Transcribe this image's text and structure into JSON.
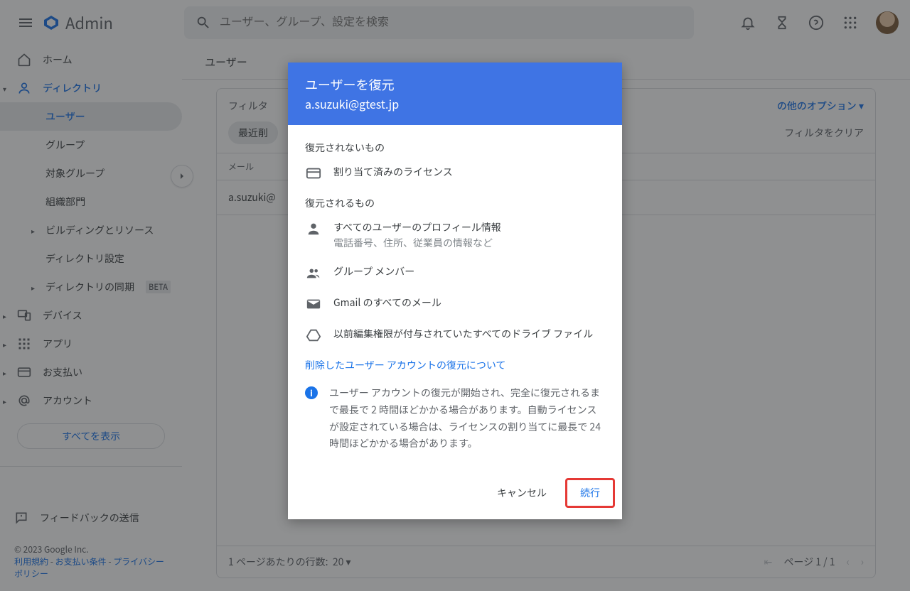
{
  "header": {
    "brand": "Admin",
    "search_placeholder": "ユーザー、グループ、設定を検索"
  },
  "sidebar": {
    "items": [
      {
        "label": "ホーム"
      },
      {
        "label": "ディレクトリ"
      },
      {
        "label": "ユーザー"
      },
      {
        "label": "グループ"
      },
      {
        "label": "対象グループ"
      },
      {
        "label": "組織部門"
      },
      {
        "label": "ビルディングとリソース"
      },
      {
        "label": "ディレクトリ設定"
      },
      {
        "label": "ディレクトリの同期"
      },
      {
        "label": "デバイス"
      },
      {
        "label": "アプリ"
      },
      {
        "label": "お支払い"
      },
      {
        "label": "アカウント"
      }
    ],
    "beta": "BETA",
    "show_all": "すべてを表示",
    "feedback": "フィードバックの送信",
    "copyright": "© 2023 Google Inc.",
    "links": {
      "terms": "利用規約",
      "billing": "お支払い条件",
      "privacy": "プライバシー ポリシー"
    }
  },
  "content": {
    "breadcrumb": "ユーザー",
    "filter_label_prefix": "フィルタ",
    "other_options": "の他のオプション",
    "chip_recent": "最近削",
    "clear_filters": "フィルタをクリア",
    "col_email": "メール",
    "row_email": "a.suzuki@",
    "footer": {
      "rows_per_page": "1 ページあたりの行数:",
      "rows_value": "20",
      "page_label": "ページ 1 / 1"
    }
  },
  "dialog": {
    "title": "ユーザーを復元",
    "subtitle": "a.suzuki@gtest.jp",
    "not_restored_label": "復元されないもの",
    "not_restored_item": "割り当て済みのライセンス",
    "restored_label": "復元されるもの",
    "restored_items": [
      {
        "text": "すべてのユーザーのプロフィール情報",
        "sub": "電話番号、住所、従業員の情報など"
      },
      {
        "text": "グループ メンバー"
      },
      {
        "text": "Gmail のすべてのメール"
      },
      {
        "text": "以前編集権限が付与されていたすべてのドライブ ファイル"
      }
    ],
    "learn_more": "削除したユーザー アカウントの復元について",
    "info": "ユーザー アカウントの復元が開始され、完全に復元されるまで最長で 2 時間ほどかかる場合があります。自動ライセンスが設定されている場合は、ライセンスの割り当てに最長で 24 時間ほどかかる場合があります。",
    "cancel": "キャンセル",
    "continue": "続行"
  }
}
